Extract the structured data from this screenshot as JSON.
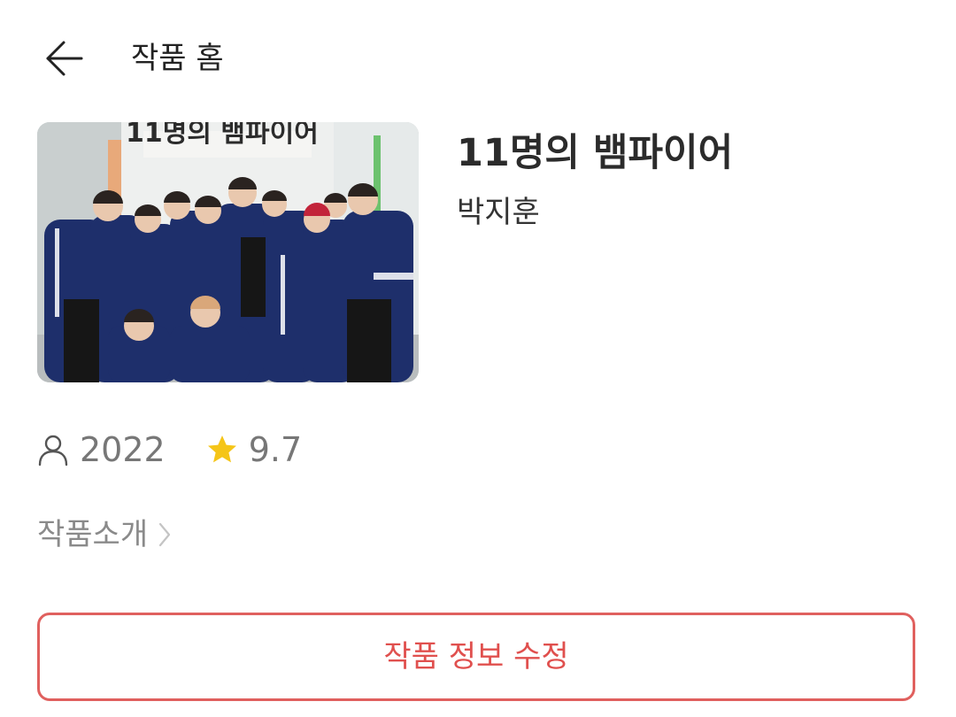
{
  "header": {
    "back_icon": "arrow-left-icon",
    "title": "작품 홈"
  },
  "work": {
    "cover_text": "11명의 뱀파이어",
    "title": "11명의 뱀파이어",
    "author": "박지훈"
  },
  "meta": {
    "person_icon": "person-icon",
    "year": "2022",
    "star_icon": "star-icon",
    "rating": "9.7"
  },
  "intro": {
    "label": "작품소개",
    "chevron_icon": "chevron-right-icon"
  },
  "actions": {
    "edit_label": "작품 정보 수정"
  },
  "colors": {
    "accent": "#e0605e",
    "star": "#f5c518",
    "muted_text": "#777777"
  }
}
